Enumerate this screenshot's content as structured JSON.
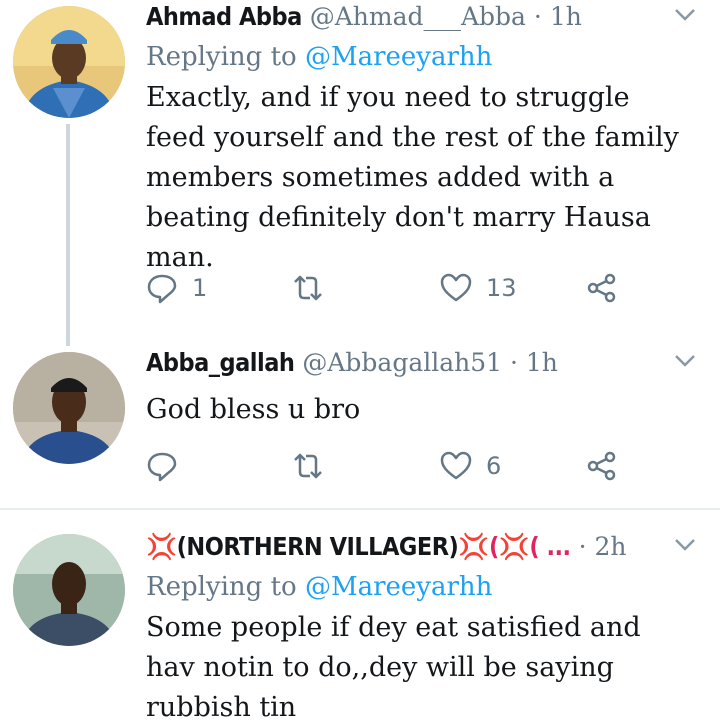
{
  "tweets": [
    {
      "name": "Ahmad Abba",
      "handle": "@Ahmad___Abba",
      "sep": "·",
      "time": "1h",
      "replying_prefix": "Replying to",
      "replying_to": "@Mareeyarhh",
      "text": "Exactly, and if you need to struggle feed yourself and the rest of the family members sometimes added with a beating definitely don't marry Hausa man.",
      "replies": "1",
      "retweets": "",
      "likes": "13"
    },
    {
      "name": "Abba_gallah",
      "handle": "@Abbagallah51",
      "sep": "·",
      "time": "1h",
      "text": "God bless u bro",
      "replies": "",
      "retweets": "",
      "likes": "6"
    },
    {
      "name_prefix": "💢",
      "name": "(NORTHERN VILLAGER)",
      "name_suffix": "💢(💢( ...",
      "sep": "·",
      "time": "2h",
      "replying_prefix": "Replying to",
      "replying_to": "@Mareeyarhh",
      "text": "Some people if dey eat satisfied and hav notin to do,,dey will be saying rubbish tin"
    }
  ],
  "icons": {
    "reply": "reply-icon",
    "retweet": "retweet-icon",
    "like": "heart-icon",
    "share": "share-icon",
    "more": "chevron-down-icon"
  },
  "colors": {
    "icon_gray": "#657786",
    "link_blue": "#1da1f2",
    "thread_line": "#ccd6dd"
  }
}
